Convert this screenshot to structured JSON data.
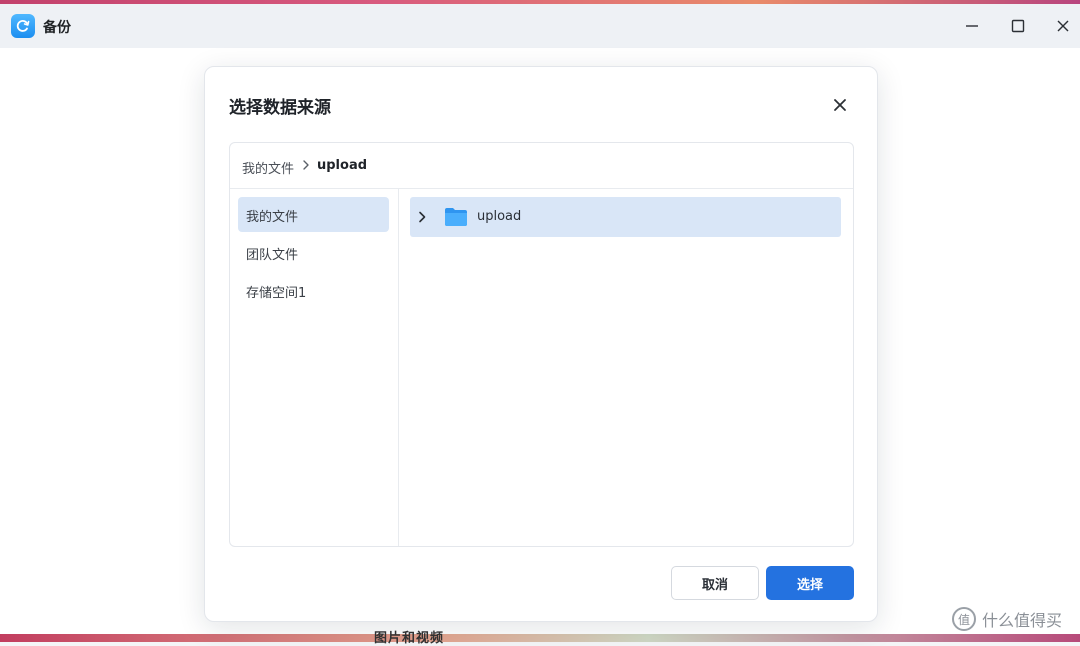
{
  "window": {
    "title": "备份"
  },
  "dialog": {
    "title": "选择数据来源",
    "breadcrumb": {
      "root": "我的文件",
      "current": "upload"
    },
    "sidebar": {
      "items": [
        {
          "label": "我的文件",
          "active": true
        },
        {
          "label": "团队文件",
          "active": false
        },
        {
          "label": "存储空间1",
          "active": false
        }
      ]
    },
    "files": [
      {
        "name": "upload",
        "type": "folder",
        "selected": true
      }
    ],
    "buttons": {
      "cancel": "取消",
      "confirm": "选择"
    }
  },
  "background": {
    "footer_text": "图片和视频"
  },
  "watermark": {
    "text": "什么值得买",
    "mark": "值"
  },
  "colors": {
    "accent": "#2472e0",
    "selection": "#d9e6f7",
    "app_icon": "#1c8ef0"
  },
  "icons": [
    "sync-icon",
    "minimize-icon",
    "maximize-icon",
    "close-icon",
    "chevron-right-icon",
    "folder-icon"
  ]
}
